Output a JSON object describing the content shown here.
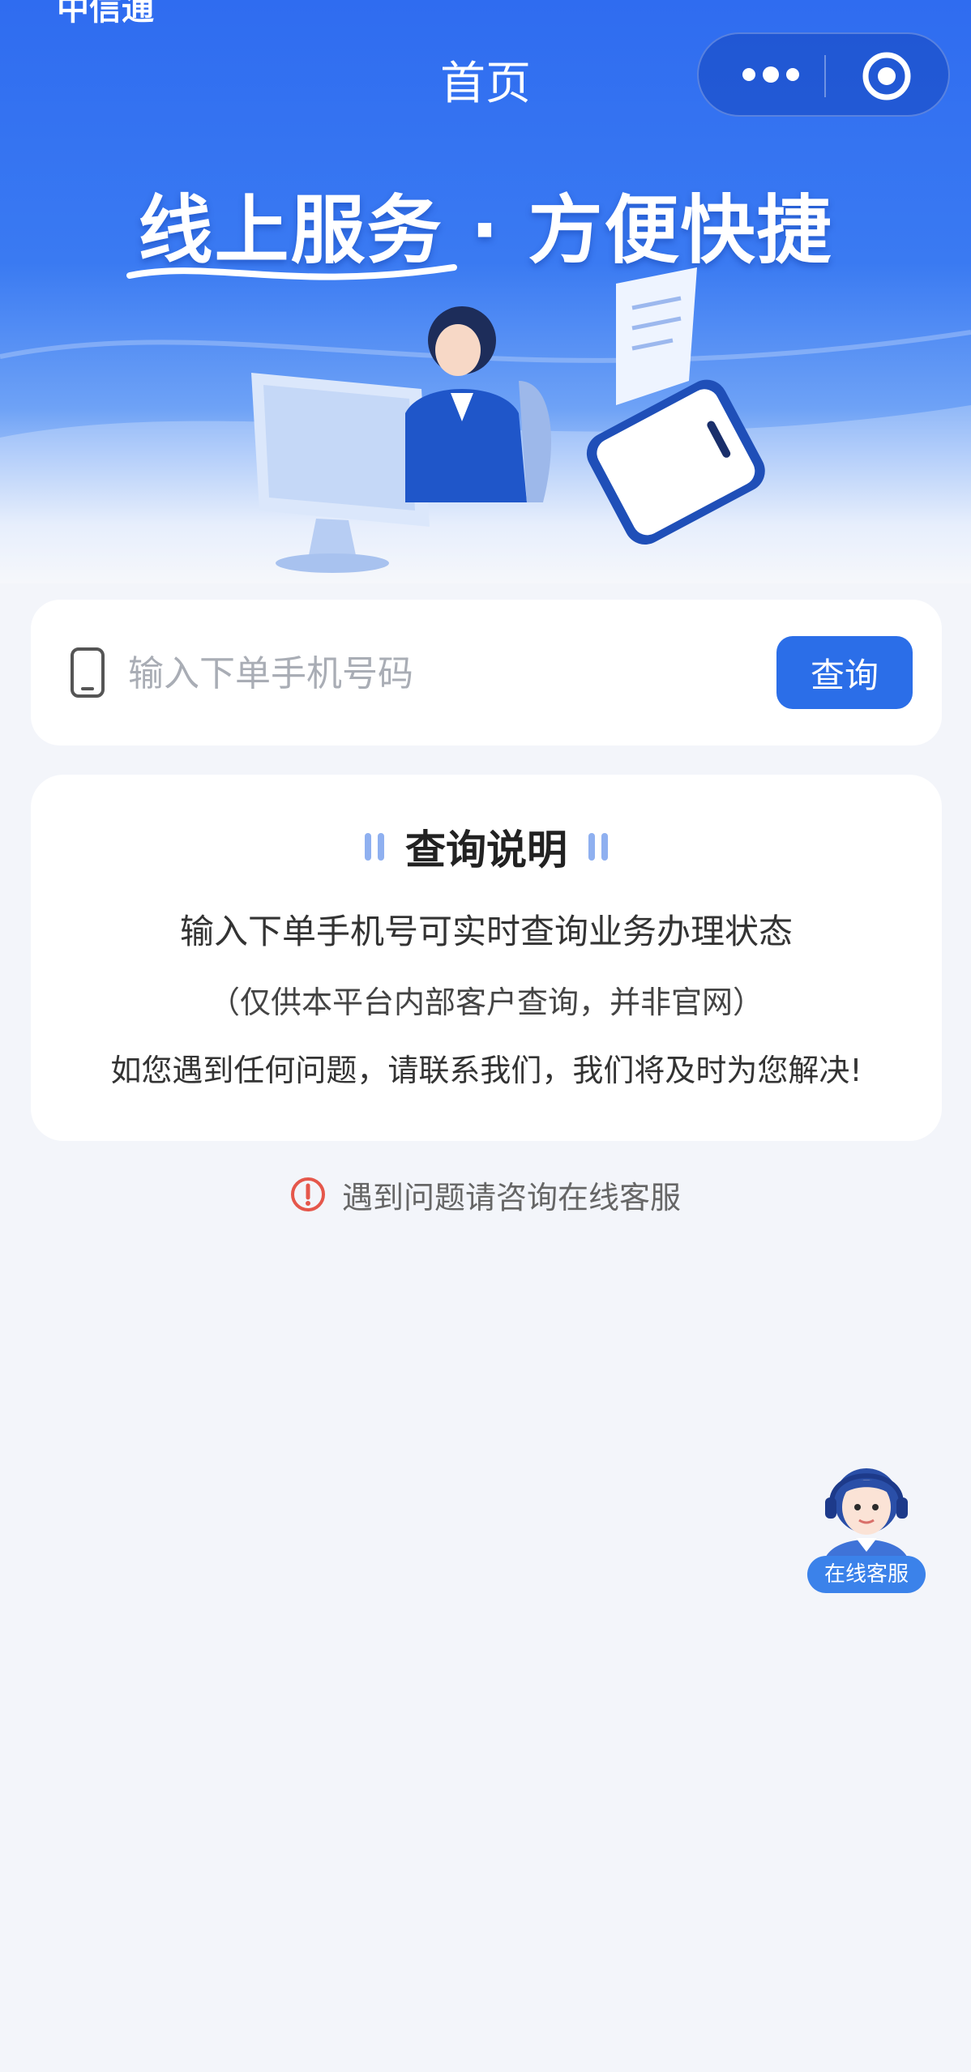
{
  "status_bar": {
    "fragment": "中信通"
  },
  "nav": {
    "title": "首页"
  },
  "banner": {
    "headline": "线上服务 · 方便快捷"
  },
  "search": {
    "placeholder": "输入下单手机号码",
    "button_label": "查询"
  },
  "info": {
    "title": "查询说明",
    "line1": "输入下单手机号可实时查询业务办理状态",
    "line2": "（仅供本平台内部客户查询，并非官网）",
    "line3": "如您遇到任何问题，请联系我们，我们将及时为您解决!"
  },
  "tip": {
    "text": "遇到问题请咨询在线客服"
  },
  "customer_service": {
    "label": "在线客服"
  },
  "colors": {
    "brand_blue": "#2b6ee8",
    "page_bg": "#f3f5fa",
    "warning_red": "#e5574b"
  }
}
